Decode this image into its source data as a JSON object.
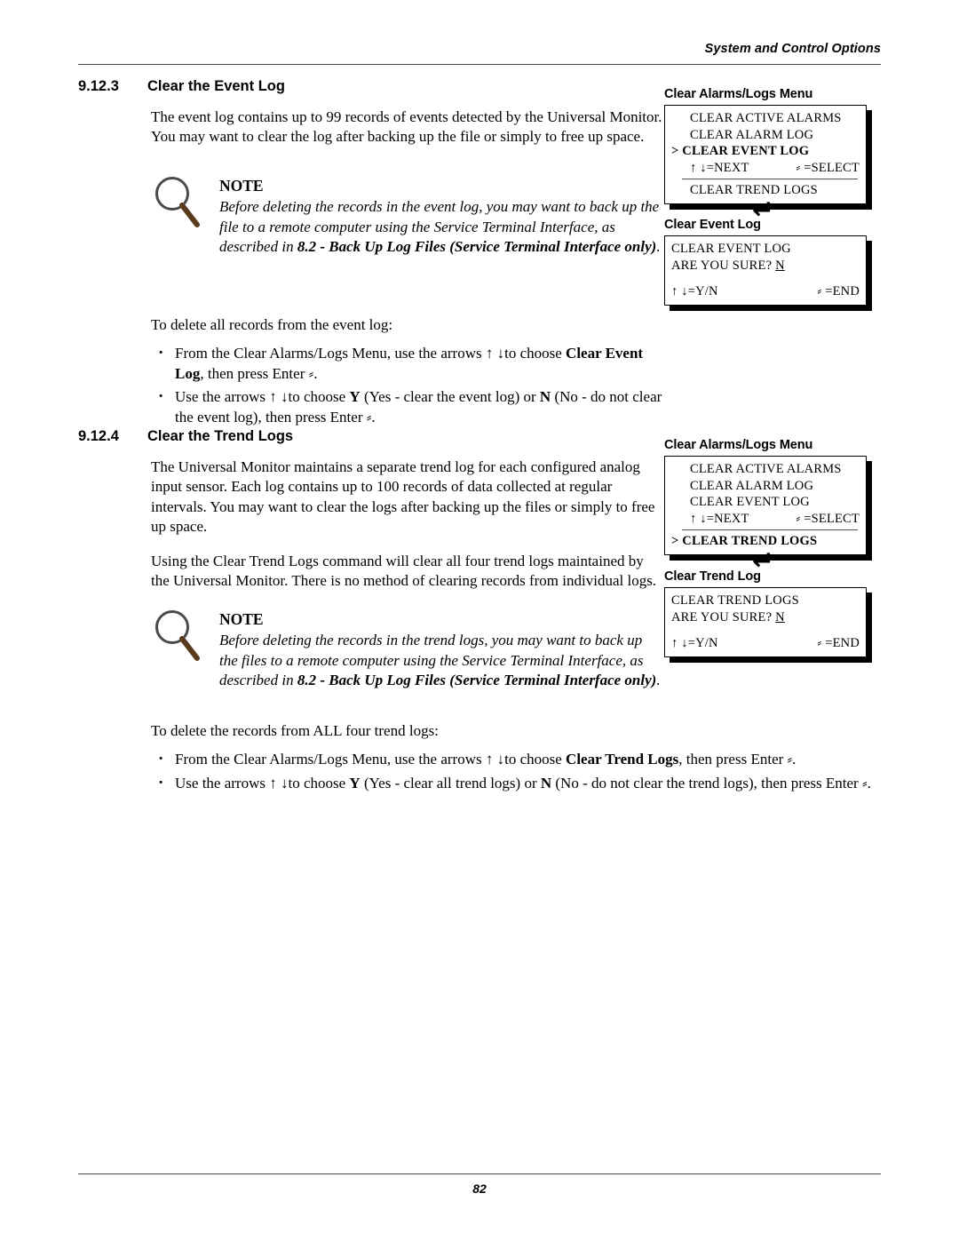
{
  "header": {
    "title": "System and Control Options"
  },
  "footer": {
    "page_number": "82"
  },
  "sections": [
    {
      "number": "9.12.3",
      "title": "Clear the Event Log",
      "paragraph": "The event log contains up to 99 records of events detected by the Universal Monitor. You may want to clear the log after backing up the file or simply to free up space.",
      "note": {
        "title": "NOTE",
        "text_part1": "Before deleting the records in the event log, you may want to back up the file to a remote computer using the Service Terminal Interface, as described in ",
        "text_bold": "8.2 - Back Up Log Files (Service Terminal Interface only)",
        "text_end": "."
      },
      "lead_in": "To delete all records from the event log:",
      "bullets": [
        {
          "part1": "From the Clear Alarms/Logs Menu, use the arrows ↑ ↓to choose ",
          "bold": "Clear Event Log",
          "part2": ", then press Enter ⸗."
        },
        {
          "part1": "Use the arrows ↑ ↓to choose ",
          "bold": "Y",
          "part2": " (Yes - clear the event log) or ",
          "bold2": "N",
          "part3": " (No - do not clear the event log), then press Enter ⸗."
        }
      ]
    },
    {
      "number": "9.12.4",
      "title": "Clear the Trend Logs",
      "paragraph1": "The Universal Monitor maintains a separate trend log for each configured analog input sensor. Each log contains up to 100 records of data collected at regular intervals. You may want to clear the logs after backing up the files or simply to free up space.",
      "paragraph2": "Using the Clear Trend Logs command will clear all four trend logs maintained by the Universal Monitor. There is no method of clearing records from individual logs.",
      "note": {
        "title": "NOTE",
        "text_part1": "Before deleting the records in the trend logs, you may want to back up the files to a remote computer using the Service Terminal Interface, as described in ",
        "text_bold": "8.2 - Back Up Log Files (Service Terminal Interface only)",
        "text_end": "."
      },
      "lead_in": "To delete the records from ALL four trend logs:",
      "bullets": [
        {
          "part1": "From the Clear Alarms/Logs Menu, use the arrows ↑ ↓to choose ",
          "bold": "Clear Trend Logs",
          "part2": ", then press Enter ⸗."
        },
        {
          "part1": "Use the arrows ↑ ↓to choose ",
          "bold": "Y",
          "part2": " (Yes - clear all trend logs) or ",
          "bold2": "N",
          "part3": " (No - do not clear the trend logs), then press Enter ⸗."
        }
      ]
    }
  ],
  "figures": {
    "panel1": {
      "label": "Clear Alarms/Logs Menu",
      "lines": [
        "CLEAR ACTIVE ALARMS",
        "CLEAR ALARM LOG",
        "CLEAR EVENT LOG",
        "↑ ↓=NEXT   ⸗ =SELECT",
        "CLEAR TREND LOGS"
      ],
      "selected_line": "> CLEAR EVENT LOG",
      "selector": ">",
      "nav_left": "↑ ↓=NEXT",
      "nav_right": "⸗ =SELECT"
    },
    "panel2": {
      "label": "Clear Event Log",
      "line1": "CLEAR EVENT LOG",
      "line2_prefix": "ARE YOU SURE? ",
      "line2_value": "N",
      "nav_left": "↑ ↓=Y/N",
      "nav_right": "⸗ =END"
    },
    "panel3": {
      "label": "Clear Alarms/Logs Menu",
      "lines": [
        "CLEAR ACTIVE ALARMS",
        "CLEAR ALARM LOG",
        "CLEAR EVENT LOG",
        "↑ ↓=NEXT   ⸗ =SELECT",
        "CLEAR TREND LOGS"
      ],
      "selected_line": "> CLEAR TREND LOGS",
      "selector": ">",
      "nav_left": "↑ ↓=NEXT",
      "nav_right": "⸗ =SELECT"
    },
    "panel4": {
      "label": "Clear Trend Log",
      "line1": "CLEAR TREND LOGS",
      "line2_prefix": "ARE YOU SURE? ",
      "line2_value": "N",
      "nav_left": "↑ ↓=Y/N",
      "nav_right": "⸗ =END"
    },
    "flow_arrow": "↵"
  }
}
